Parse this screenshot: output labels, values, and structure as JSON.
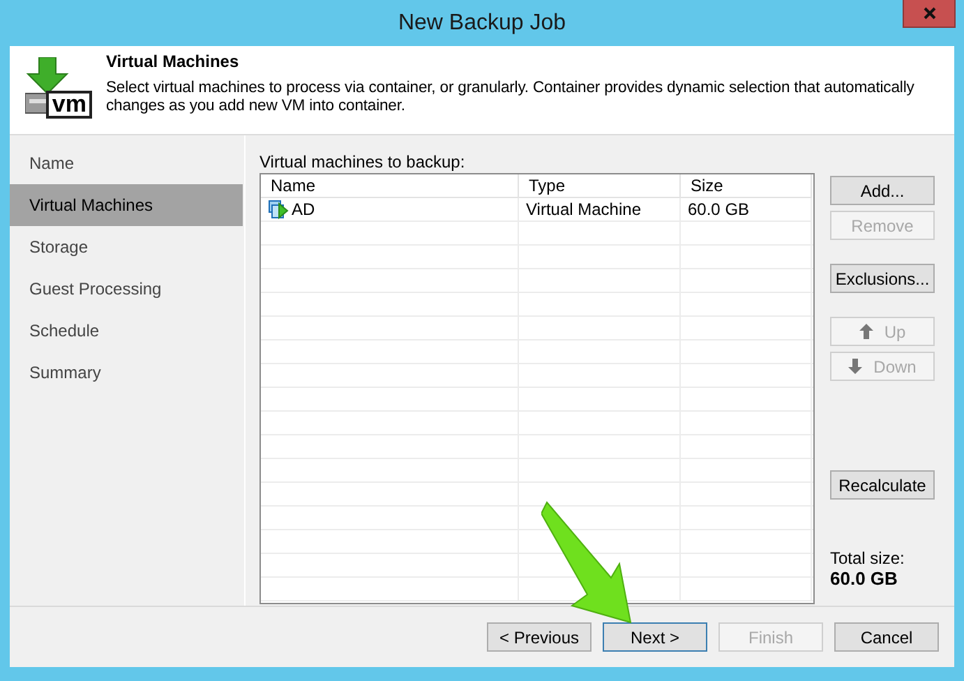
{
  "window": {
    "title": "New Backup Job"
  },
  "header": {
    "icon_label": "vm",
    "title": "Virtual Machines",
    "description": "Select virtual machines to process via container, or granularly. Container provides dynamic selection that automatically changes as you add new VM into container."
  },
  "steps": [
    {
      "label": "Name",
      "selected": false
    },
    {
      "label": "Virtual Machines",
      "selected": true
    },
    {
      "label": "Storage",
      "selected": false
    },
    {
      "label": "Guest Processing",
      "selected": false
    },
    {
      "label": "Schedule",
      "selected": false
    },
    {
      "label": "Summary",
      "selected": false
    }
  ],
  "list_label": "Virtual machines to backup:",
  "table": {
    "columns": [
      "Name",
      "Type",
      "Size"
    ],
    "rows": [
      {
        "name": "AD",
        "type": "Virtual Machine",
        "size": "60.0 GB"
      }
    ]
  },
  "side_buttons": [
    {
      "label": "Add...",
      "disabled": false,
      "kind": "plain"
    },
    {
      "label": "Remove",
      "disabled": true,
      "kind": "plain"
    },
    {
      "label": "Exclusions...",
      "disabled": false,
      "kind": "plain"
    },
    {
      "label": "Up",
      "disabled": true,
      "kind": "up"
    },
    {
      "label": "Down",
      "disabled": true,
      "kind": "down"
    },
    {
      "label": "Recalculate",
      "disabled": false,
      "kind": "plain"
    }
  ],
  "total": {
    "label": "Total size:",
    "value": "60.0 GB"
  },
  "footer_buttons": [
    {
      "label": "< Previous",
      "disabled": false,
      "default": false
    },
    {
      "label": "Next >",
      "disabled": false,
      "default": true
    },
    {
      "label": "Finish",
      "disabled": true,
      "default": false
    },
    {
      "label": "Cancel",
      "disabled": false,
      "default": false
    }
  ]
}
